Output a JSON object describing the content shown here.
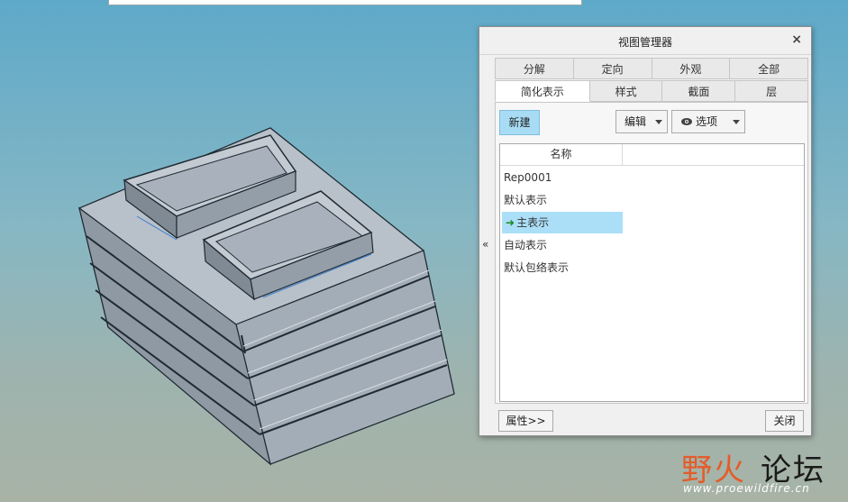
{
  "dialog": {
    "title": "视图管理器",
    "close_glyph": "×",
    "collapse_glyph": "«",
    "tabs_row1": [
      "分解",
      "定向",
      "外观",
      "全部"
    ],
    "tabs_row2": [
      "简化表示",
      "样式",
      "截面",
      "层"
    ],
    "active_tab": "简化表示",
    "new_label": "新建",
    "edit_label": "编辑",
    "options_label": "选项",
    "column_name": "名称",
    "rows": [
      "Rep0001",
      "默认表示",
      "主表示",
      "自动表示",
      "默认包络表示"
    ],
    "selected_row": "主表示",
    "properties_label": "属性>>",
    "close_label": "关闭"
  },
  "watermark": {
    "cn_colored": "野火",
    "cn_dark": "论坛",
    "url": "www.proewildfire.cn"
  },
  "colors": {
    "selection": "#abdff8",
    "new_button": "#a8dcf5",
    "model_face": "#b4bcc6",
    "model_edge": "#1f2a33"
  },
  "icons": {
    "eye": "eye-icon",
    "arrow": "green-arrow-icon",
    "close": "close-icon"
  }
}
